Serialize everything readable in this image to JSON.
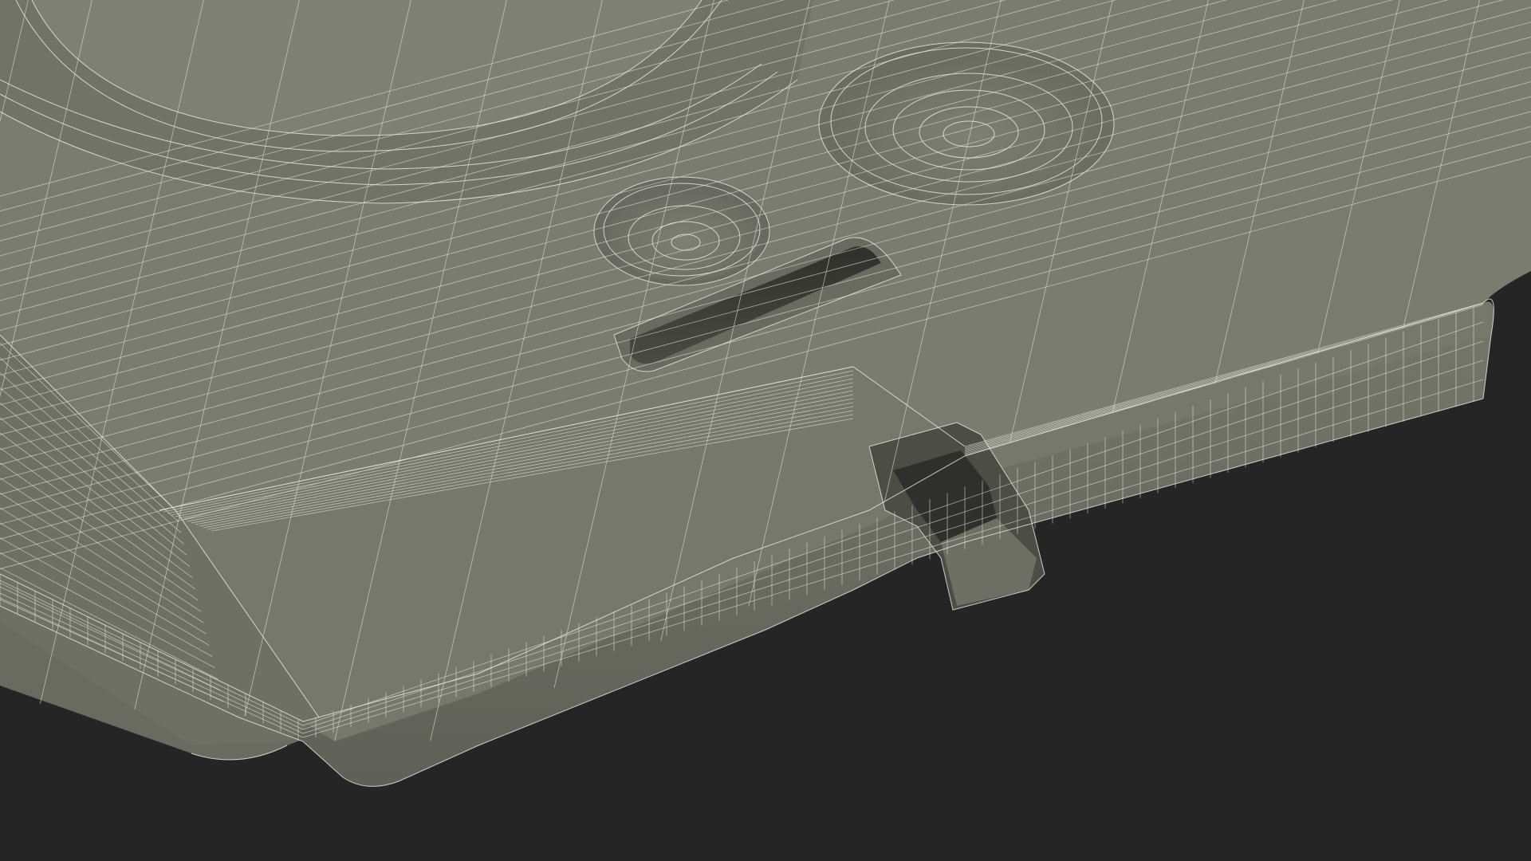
{
  "scene": {
    "subject": "wireframe-3d-model-render",
    "colors": {
      "background": "#252525",
      "surface": "#7b7c70",
      "surface_dark": "#6c6d62",
      "surface_light": "#85867a",
      "side": "#6f7065",
      "cavity": "#4a4b43",
      "cavity_deep": "#2e2f2a",
      "wire": "#e6e6dc"
    }
  }
}
